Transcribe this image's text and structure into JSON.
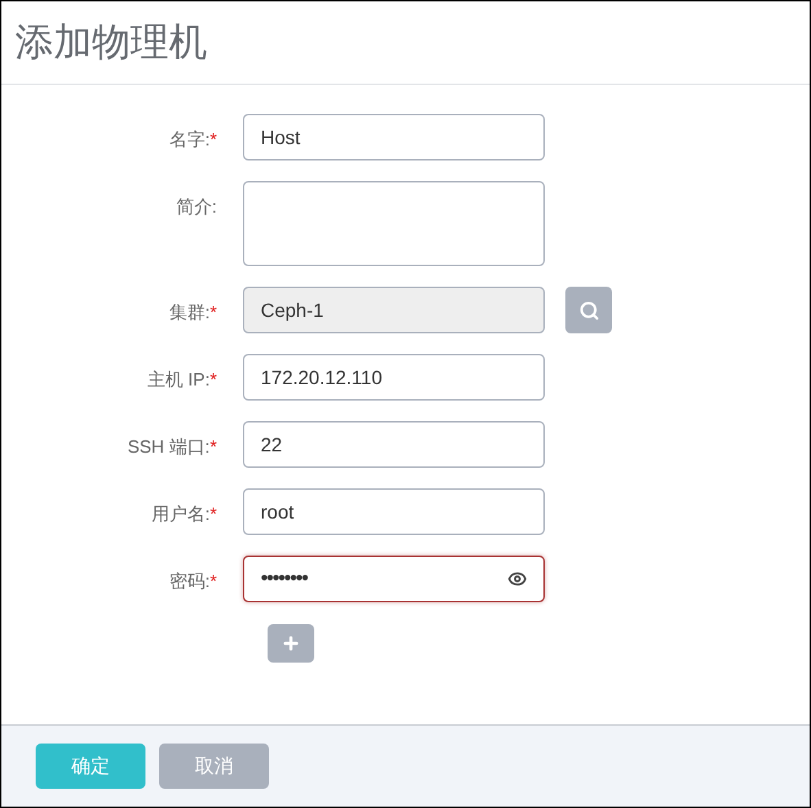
{
  "title": "添加物理机",
  "fields": [
    {
      "kind": "text",
      "label": "名字:",
      "required": true,
      "value": "Host"
    },
    {
      "kind": "textarea",
      "label": "简介:",
      "required": false
    },
    {
      "kind": "lookup",
      "label": "集群:",
      "required": true,
      "value": "Ceph-1",
      "disabled": true
    },
    {
      "kind": "text",
      "label": "主机 IP:",
      "required": true,
      "value": "172.20.12.110"
    },
    {
      "kind": "text",
      "label": "SSH 端口:",
      "required": true,
      "value": "22"
    },
    {
      "kind": "text",
      "label": "用户名:",
      "required": true,
      "value": "root"
    },
    {
      "kind": "password",
      "label": "密码:",
      "required": true,
      "value": "••••••••",
      "error": true
    }
  ],
  "required_mark": "*",
  "buttons": [
    {
      "label": "确定",
      "kind": "primary"
    },
    {
      "label": "取消",
      "kind": "secondary"
    }
  ]
}
